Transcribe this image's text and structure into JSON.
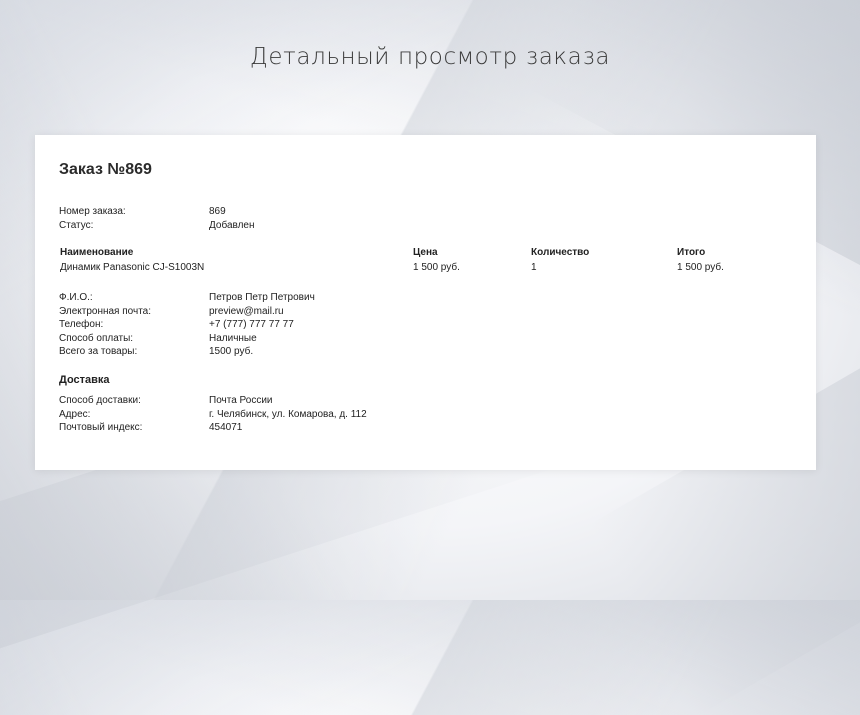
{
  "page": {
    "heading": "Детальный просмотр заказа"
  },
  "order": {
    "title": "Заказ №869",
    "fields": [
      {
        "label": "Номер заказа:",
        "value": "869"
      },
      {
        "label": "Статус:",
        "value": "Добавлен"
      }
    ]
  },
  "items": {
    "columns": [
      "Наименование",
      "Цена",
      "Количество",
      "Итого"
    ],
    "rows": [
      [
        "Динамик Panasonic CJ-S1003N",
        "1 500 руб.",
        "1",
        "1 500 руб."
      ]
    ]
  },
  "customer": {
    "fields": [
      {
        "label": "Ф.И.О.:",
        "value": "Петров Петр Петрович"
      },
      {
        "label": "Электронная почта:",
        "value": "preview@mail.ru"
      },
      {
        "label": "Телефон:",
        "value": "+7 (777) 777 77 77"
      },
      {
        "label": "Способ оплаты:",
        "value": "Наличные"
      },
      {
        "label": "Всего за товары:",
        "value": "1500 руб."
      }
    ]
  },
  "delivery": {
    "title": "Доставка",
    "fields": [
      {
        "label": "Способ доставки:",
        "value": "Почта России"
      },
      {
        "label": "Адрес:",
        "value": "г. Челябинск, ул. Комарова, д. 112"
      },
      {
        "label": "Почтовый индекс:",
        "value": "454071"
      }
    ]
  }
}
